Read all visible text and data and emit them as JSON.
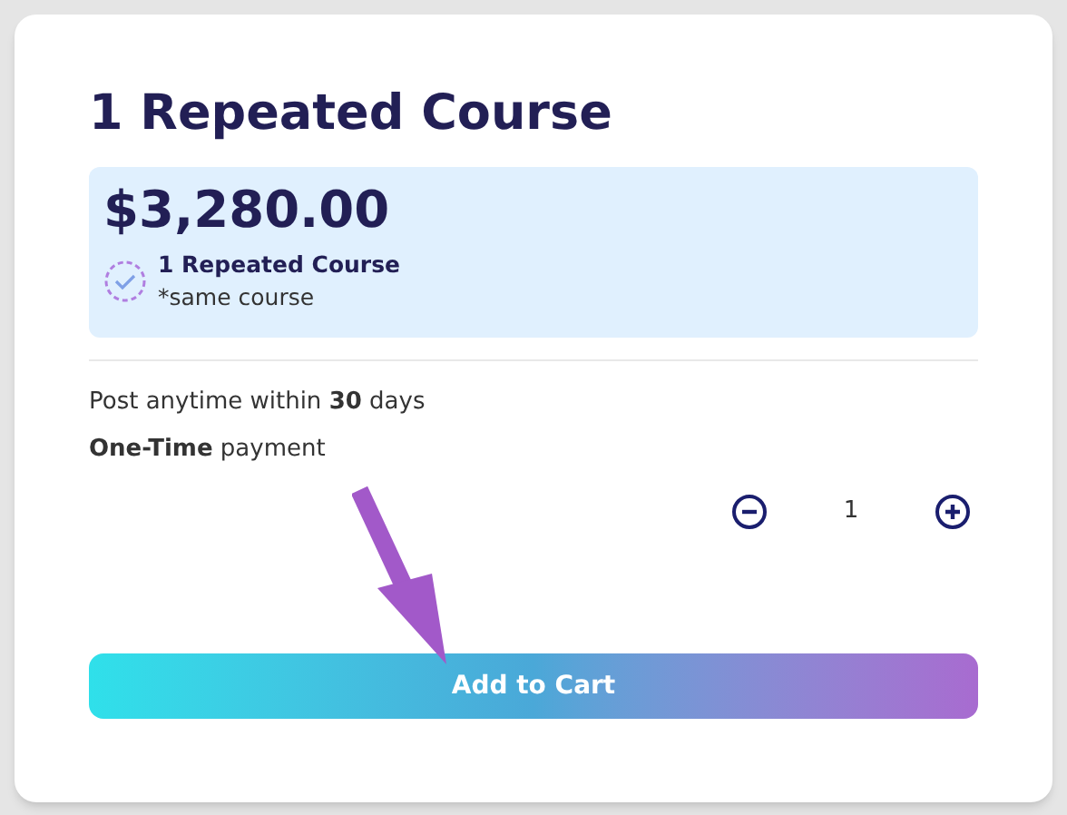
{
  "title": "1 Repeated Course",
  "offer": {
    "price": "$3,280.00",
    "name": "1 Repeated Course",
    "note": "*same course"
  },
  "terms": [
    "Post anytime within **30** days",
    "**One-Time** payment"
  ],
  "quantity": {
    "value": "1"
  },
  "button": {
    "label": "Add to Cart"
  }
}
